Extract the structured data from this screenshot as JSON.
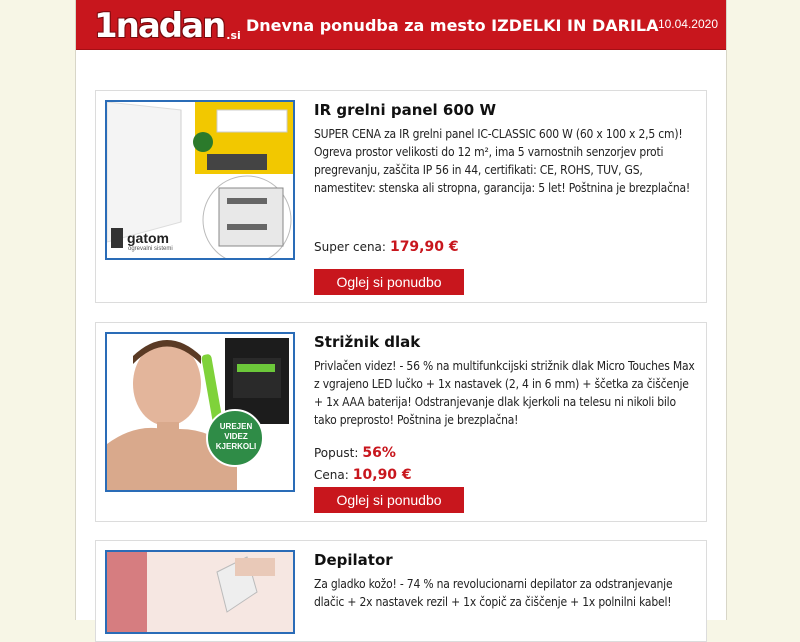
{
  "header": {
    "logo_text": "1nadan",
    "logo_domain": ".si",
    "title_prefix": "Dnevna ponudba za mesto",
    "city": "IZDELKI IN DARILA",
    "date": "10.04.2020"
  },
  "offers": [
    {
      "title": "IR grelni panel 600 W",
      "description": "SUPER CENA za IR grelni panel IC-CLASSIC 600 W (60 x 100 x 2,5 cm)! Ogreva prostor velikosti do 12 m², ima 5 varnostnih senzorjev proti pregrevanju, zaščita IP 56 in 44, certifikati: CE, ROHS, TUV, GS, namestitev: stenska ali stropna, garancija: 5 let! Poštnina je brezplačna!",
      "price_label": "Super cena:",
      "price": "179,90 €",
      "button": "Oglej si ponudbo",
      "brand": "gatom",
      "brand_sub": "ogrevalni sistemi"
    },
    {
      "title": "Strižnik dlak",
      "description": "Privlačen videz! - 56 % na multifunkcijski strižnik dlak Micro Touches Max z vgrajeno LED lučko + 1x nastavek (2, 4 in 6 mm) + ščetka za čiščenje + 1x AAA baterija! Odstranjevanje dlak kjerkoli na telesu ni nikoli bilo tako preprosto! Poštnina je brezplačna!",
      "discount_label": "Popust:",
      "discount": "56%",
      "price_label": "Cena:",
      "price": "10,90 €",
      "button": "Oglej si ponudbo",
      "badge": [
        "UREJEN",
        "VIDEZ",
        "KJERKOLI"
      ]
    },
    {
      "title": "Depilator",
      "description": "Za gladko kožo! - 74 % na revolucionarni depilator za odstranjevanje dlačic + 2x nastavek rezil + 1x čopič za čiščenje + 1x polnilni kabel!"
    }
  ]
}
